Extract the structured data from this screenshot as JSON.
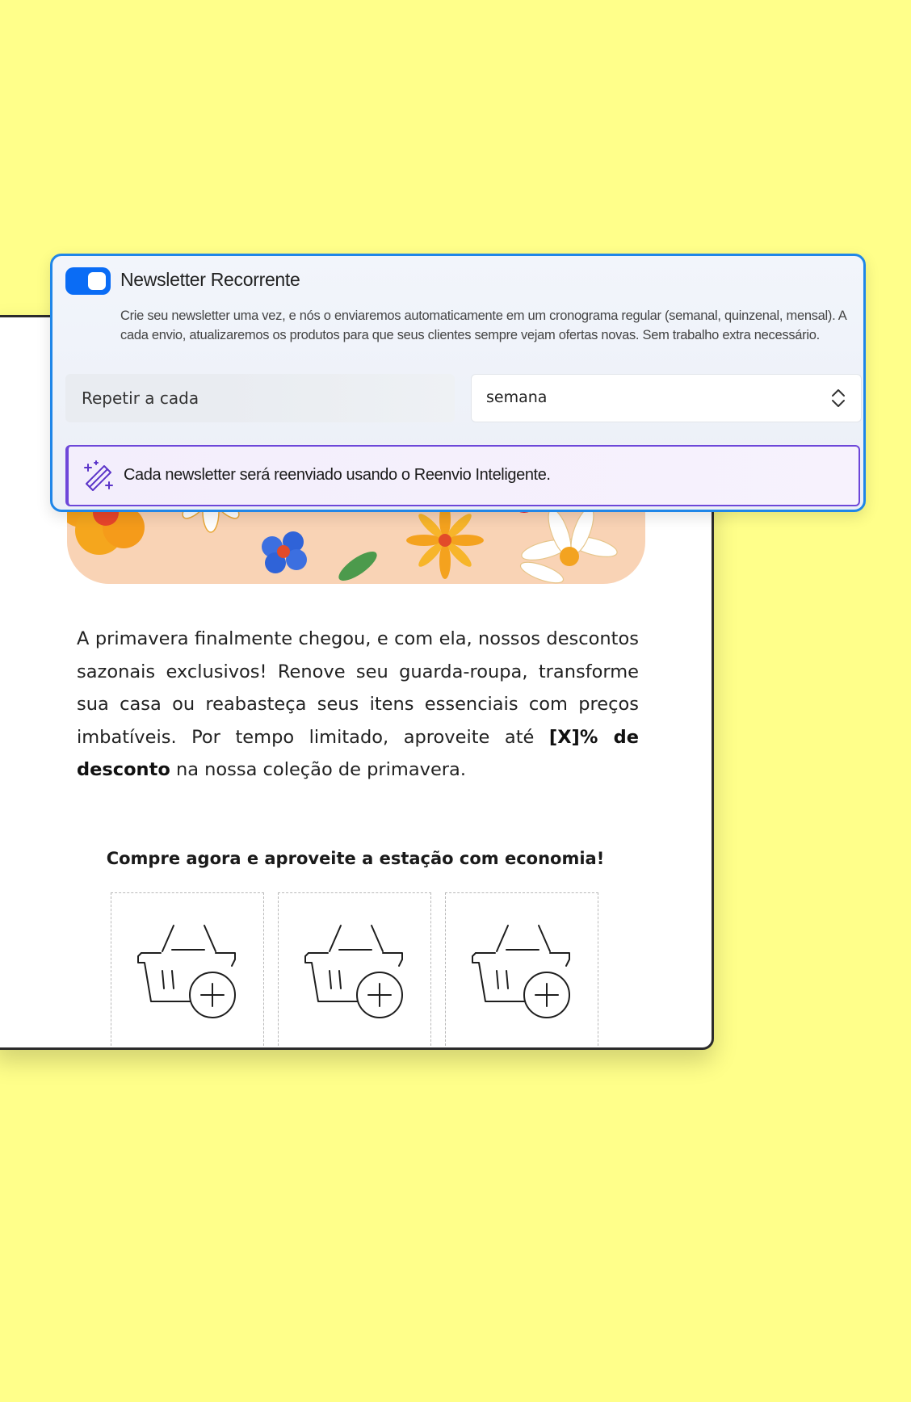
{
  "recurring": {
    "enabled": true,
    "title": "Newsletter Recorrente",
    "description": "Crie seu newsletter uma vez, e nós o enviaremos automaticamente em um cronograma regular (semanal, quinzenal, mensal). A cada envio, atualizaremos os produtos para que seus clientes sempre vejam ofertas novas. Sem trabalho extra necessário.",
    "repeat_label": "Repetir a cada",
    "frequency_value": "semana",
    "smart_resend_note": "Cada newsletter será reenviado usando o Reenvio Inteligente."
  },
  "email": {
    "body_part1": "A primavera finalmente chegou, e com ela, nossos descontos sazonais exclusivos! Renove seu guarda-roupa, transforme sua casa ou reabasteça seus itens essenciais com preços imbatíveis. Por tempo limitado, aproveite até ",
    "body_bold": "[X]% de desconto",
    "body_part2": " na nossa coleção de primavera.",
    "cta": "Compre agora e aproveite a estação com economia!",
    "product_slots": [
      {
        "icon": "basket-add-icon"
      },
      {
        "icon": "basket-add-icon"
      },
      {
        "icon": "basket-add-icon"
      }
    ]
  },
  "colors": {
    "background": "#ffff8a",
    "accent": "#0a6cf5",
    "smart_border": "#6d47d9"
  }
}
